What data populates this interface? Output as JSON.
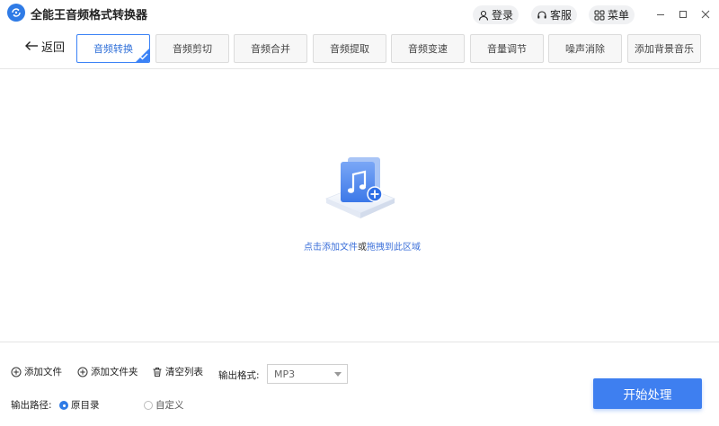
{
  "app": {
    "title": "全能王音频格式转换器",
    "accent_color": "#3e7ff0",
    "logo_icon": "refresh-music-icon"
  },
  "titlebar": {
    "login_label": "登录",
    "service_label": "客服",
    "menu_label": "菜单"
  },
  "toolbar": {
    "back_label": "返回",
    "tabs": [
      {
        "label": "音频转换",
        "active": true
      },
      {
        "label": "音频剪切",
        "active": false
      },
      {
        "label": "音频合并",
        "active": false
      },
      {
        "label": "音频提取",
        "active": false
      },
      {
        "label": "音频变速",
        "active": false
      },
      {
        "label": "音量调节",
        "active": false
      },
      {
        "label": "噪声消除",
        "active": false
      },
      {
        "label": "添加背景音乐",
        "active": false
      }
    ]
  },
  "drop_area": {
    "click_text": "点击添加文件",
    "or_text": "或",
    "drag_text": "拖拽到此区域"
  },
  "bottom": {
    "add_file_label": "添加文件",
    "add_folder_label": "添加文件夹",
    "clear_list_label": "清空列表",
    "format_label": "输出格式:",
    "format_value": "MP3",
    "path_label": "输出路径:",
    "path_options": [
      {
        "label": "原目录",
        "selected": true
      },
      {
        "label": "自定义",
        "selected": false
      }
    ],
    "start_label": "开始处理"
  }
}
